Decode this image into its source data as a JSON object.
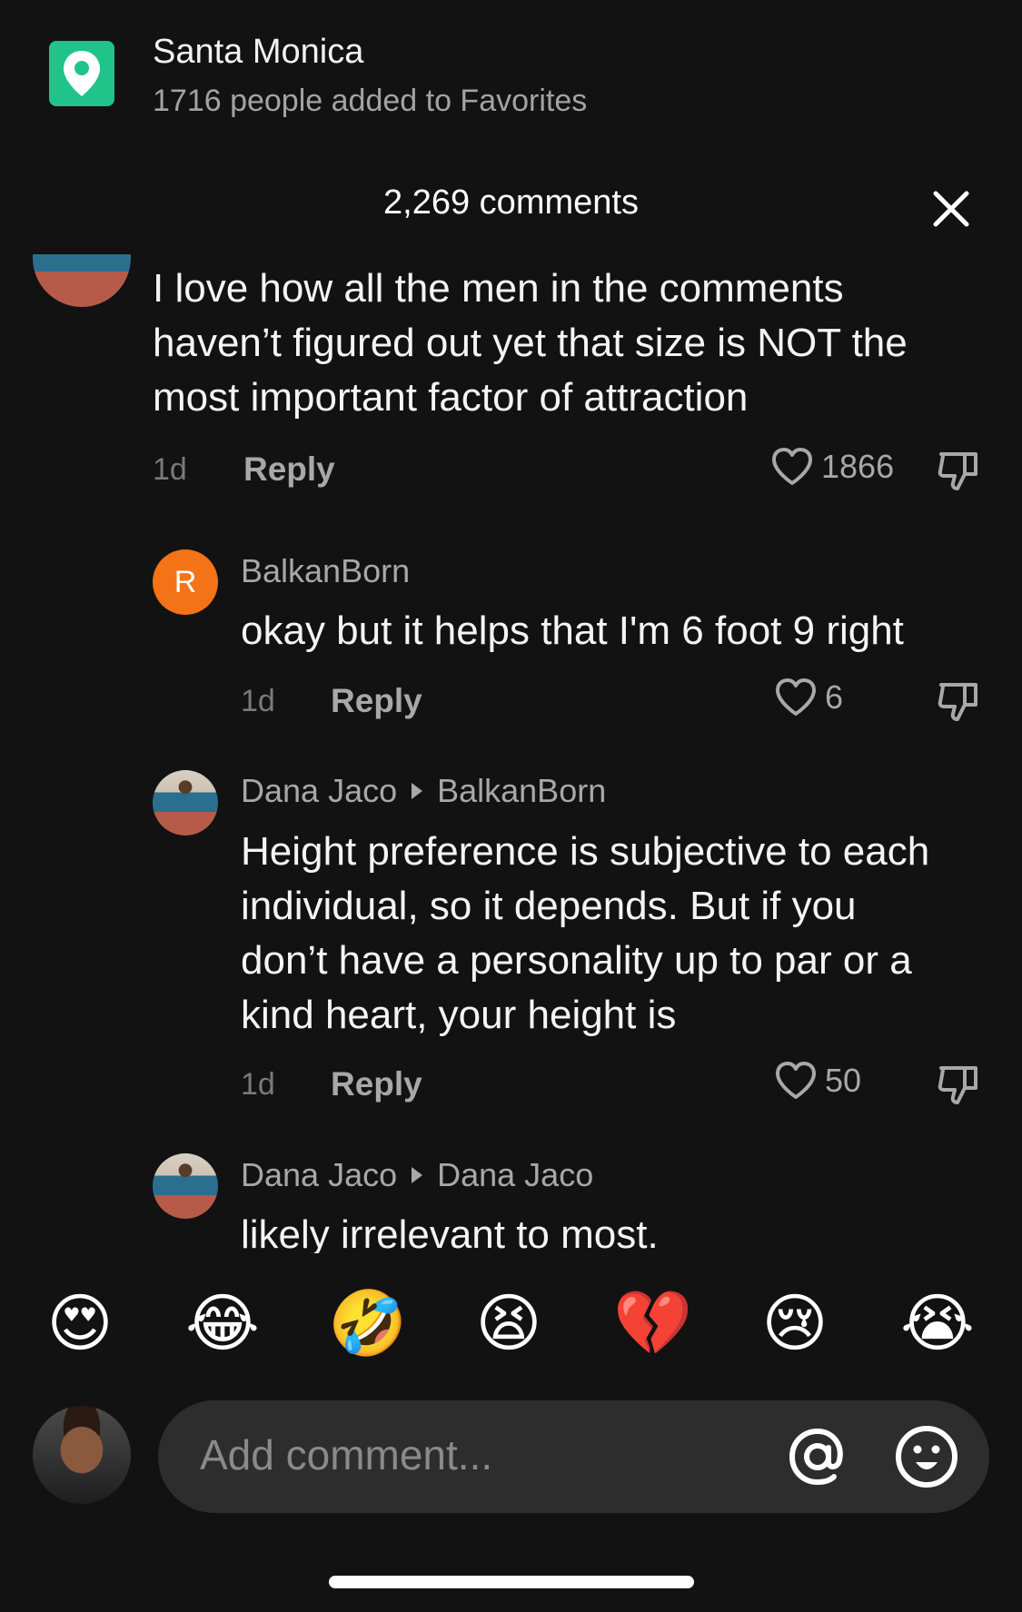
{
  "location": {
    "title": "Santa Monica",
    "subtitle": "1716 people added to Favorites",
    "icon": "location-pin-icon",
    "accent_color": "#20c389"
  },
  "header": {
    "comments_count": "2,269 comments",
    "close_icon": "close-icon"
  },
  "comments": [
    {
      "text_lines": [
        "I love how all the men in the comments",
        "haven’t figured out yet that size is NOT the",
        "most important factor of attraction"
      ],
      "time": "1d",
      "reply_label": "Reply",
      "likes": "1866"
    },
    {
      "avatar_letter": "R",
      "user": "BalkanBorn",
      "text_lines": [
        "okay but it helps that I'm 6 foot 9 right"
      ],
      "time": "1d",
      "reply_label": "Reply",
      "likes": "6"
    },
    {
      "user": "Dana Jaco",
      "reply_to": "BalkanBorn",
      "text_lines": [
        "Height preference is subjective to each",
        "individual, so it depends. But if you",
        "don’t have a personality up to par or a",
        "kind heart, your height is"
      ],
      "time": "1d",
      "reply_label": "Reply",
      "likes": "50"
    },
    {
      "user": "Dana Jaco",
      "reply_to": "Dana Jaco",
      "text_lines": [
        "likely irrelevant to most."
      ]
    }
  ],
  "emoji_bar": [
    "😍",
    "😂",
    "🤣",
    "😫",
    "💔",
    "😢",
    "😭"
  ],
  "input": {
    "placeholder": "Add comment...",
    "mention_icon": "at-icon",
    "emoji_icon": "smile-icon"
  }
}
